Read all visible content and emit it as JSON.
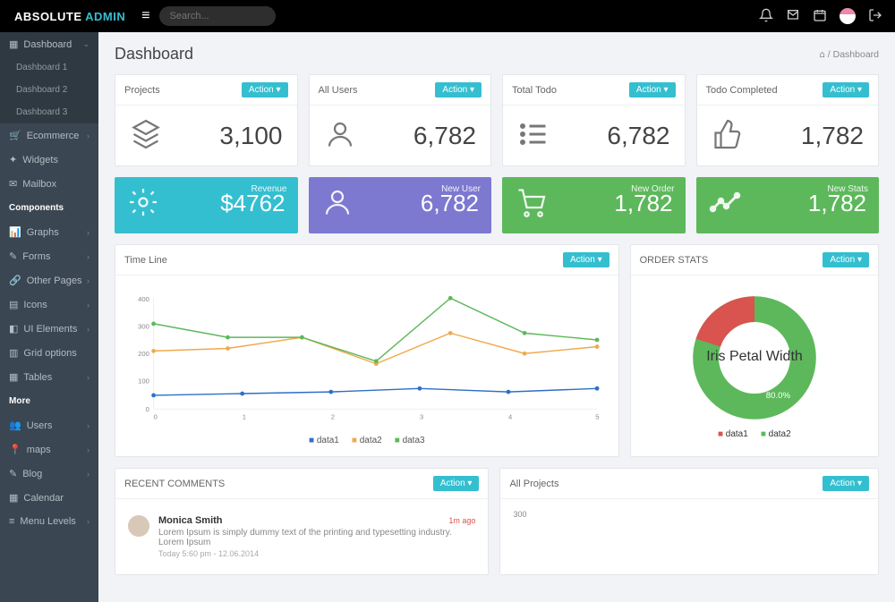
{
  "brand": {
    "a": "ABSOLUTE",
    "b": "ADMIN"
  },
  "search": {
    "placeholder": "Search..."
  },
  "page": {
    "title": "Dashboard"
  },
  "breadcrumb": {
    "sep": "/",
    "current": "Dashboard"
  },
  "sidebar": {
    "items": [
      {
        "label": "Dashboard",
        "icon": "dashboard"
      },
      {
        "label": "Dashboard 1"
      },
      {
        "label": "Dashboard 2"
      },
      {
        "label": "Dashboard 3"
      },
      {
        "label": "Ecommerce",
        "icon": "cart"
      },
      {
        "label": "Widgets",
        "icon": "gear"
      },
      {
        "label": "Mailbox",
        "icon": "mail"
      }
    ],
    "components_header": "Components",
    "components": [
      {
        "label": "Graphs",
        "icon": "graph"
      },
      {
        "label": "Forms",
        "icon": "form"
      },
      {
        "label": "Other Pages",
        "icon": "link"
      },
      {
        "label": "Icons",
        "icon": "grid"
      },
      {
        "label": "UI Elements",
        "icon": "ui"
      },
      {
        "label": "Grid options",
        "icon": "layout"
      },
      {
        "label": "Tables",
        "icon": "table"
      }
    ],
    "more_header": "More",
    "more": [
      {
        "label": "Users",
        "icon": "users"
      },
      {
        "label": "maps",
        "icon": "map"
      },
      {
        "label": "Blog",
        "icon": "pencil"
      },
      {
        "label": "Calendar",
        "icon": "calendar"
      },
      {
        "label": "Menu Levels",
        "icon": "menu"
      }
    ]
  },
  "action_label": "Action",
  "stats": [
    {
      "title": "Projects",
      "value": "3,100",
      "icon": "layers"
    },
    {
      "title": "All Users",
      "value": "6,782",
      "icon": "user"
    },
    {
      "title": "Total Todo",
      "value": "6,782",
      "icon": "list"
    },
    {
      "title": "Todo Completed",
      "value": "1,782",
      "icon": "thumb"
    }
  ],
  "tiles": [
    {
      "label": "Revenue",
      "value": "$4762",
      "cls": "t-teal",
      "icon": "gear"
    },
    {
      "label": "New User",
      "value": "6,782",
      "cls": "t-purple",
      "icon": "user"
    },
    {
      "label": "New Order",
      "value": "1,782",
      "cls": "t-green",
      "icon": "cart"
    },
    {
      "label": "New Stats",
      "value": "1,782",
      "cls": "t-green",
      "icon": "trend"
    }
  ],
  "timeline": {
    "title": "Time Line",
    "legend": [
      "data1",
      "data2",
      "data3"
    ]
  },
  "order_stats": {
    "title": "ORDER STATS",
    "center": "Iris Petal Width",
    "legend": [
      "data1",
      "data2"
    ],
    "p1": "20.0%",
    "p2": "80.0%"
  },
  "comments": {
    "title": "RECENT COMMENTS",
    "item": {
      "name": "Monica Smith",
      "ago": "1m ago",
      "text": "Lorem Ipsum is simply dummy text of the printing and typesetting industry. Lorem Ipsum",
      "ts": "Today 5:60 pm - 12.06.2014"
    }
  },
  "projects_panel": {
    "title": "All Projects",
    "y0": "300"
  },
  "chart_data": [
    {
      "type": "line",
      "title": "Time Line",
      "x": [
        0,
        1,
        2,
        3,
        4,
        5
      ],
      "ylim": [
        0,
        400
      ],
      "yticks": [
        100,
        200,
        300,
        400
      ],
      "series": [
        {
          "name": "data1",
          "values": [
            50,
            55,
            60,
            75,
            60,
            75
          ],
          "color": "#2e6fc7"
        },
        {
          "name": "data2",
          "values": [
            210,
            220,
            260,
            165,
            275,
            200,
            225
          ],
          "color": "#f0a94c"
        },
        {
          "name": "data3",
          "values": [
            310,
            260,
            260,
            175,
            400,
            275,
            250
          ],
          "color": "#5db85c"
        }
      ]
    },
    {
      "type": "pie",
      "title": "ORDER STATS",
      "center_label": "Iris Petal Width",
      "series": [
        {
          "name": "data1",
          "value": 20.0,
          "color": "#d9534f"
        },
        {
          "name": "data2",
          "value": 80.0,
          "color": "#5db85c"
        }
      ]
    }
  ]
}
